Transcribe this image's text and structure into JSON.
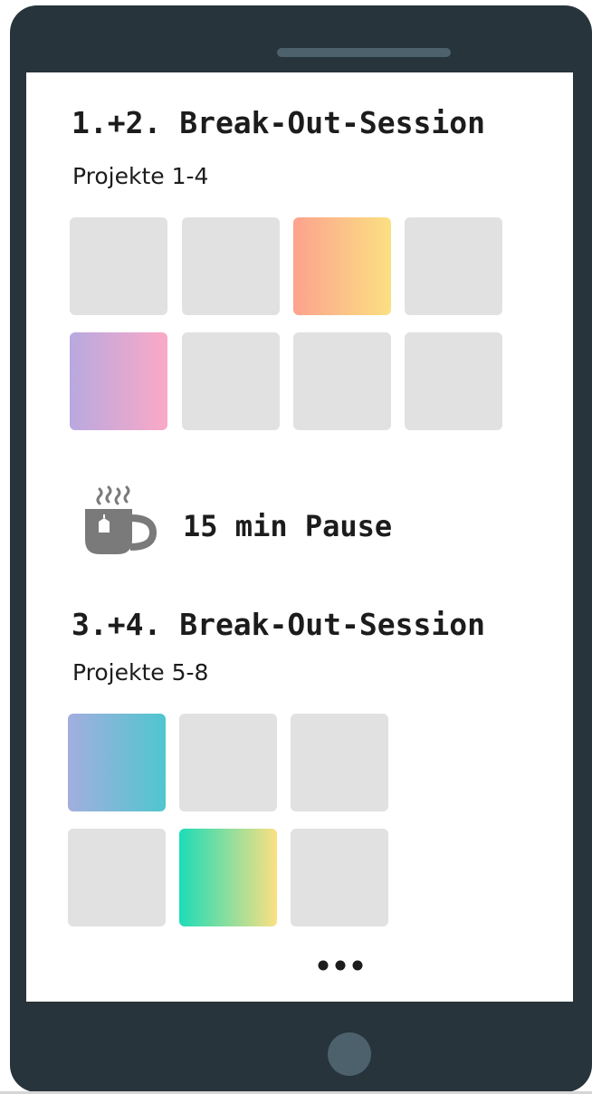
{
  "session1": {
    "title": "1.+2. Break-Out-Session",
    "subtitle": "Projekte 1-4",
    "tiles": [
      {
        "fill": "none"
      },
      {
        "fill": "none"
      },
      {
        "fill": "gradient",
        "from": "#fda28e",
        "to": "#fbe082"
      },
      {
        "fill": "none"
      },
      {
        "fill": "gradient",
        "from": "#b8a9e0",
        "to": "#fba9c6"
      },
      {
        "fill": "none"
      },
      {
        "fill": "none"
      },
      {
        "fill": "none"
      }
    ]
  },
  "pause": {
    "label": "15 min Pause",
    "icon": "coffee-cup-icon"
  },
  "session2": {
    "title": "3.+4. Break-Out-Session",
    "subtitle": "Projekte 5-8",
    "tiles": [
      {
        "fill": "gradient",
        "from": "#a3aedf",
        "to": "#4fc6cf"
      },
      {
        "fill": "none"
      },
      {
        "fill": "none"
      },
      {
        "fill": "none"
      },
      {
        "fill": "gradient",
        "from": "#1ddcb8",
        "to": "#fbe082"
      },
      {
        "fill": "none"
      }
    ]
  },
  "more": {
    "icon": "ellipsis-icon"
  },
  "colors": {
    "device": "#27343b",
    "device_accent": "#4d616d",
    "tile_empty": "#e1e1e1"
  }
}
